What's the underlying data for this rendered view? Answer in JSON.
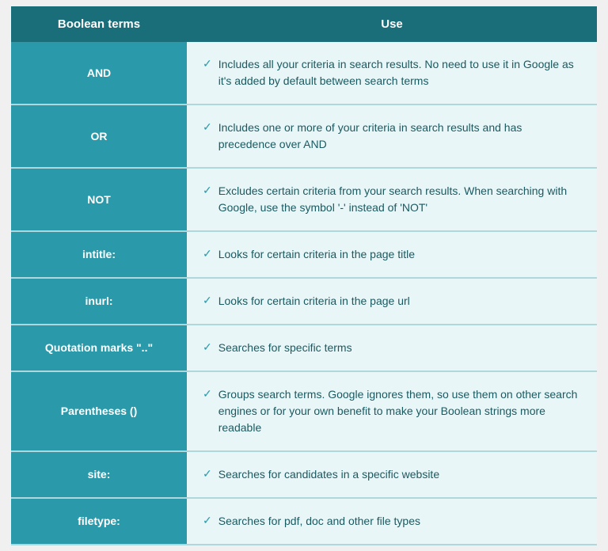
{
  "table": {
    "header": {
      "col1": "Boolean terms",
      "col2": "Use"
    },
    "rows": [
      {
        "term": "AND",
        "use": "Includes all your criteria in search results. No need to use it in Google as it's added by default between search terms"
      },
      {
        "term": "OR",
        "use": "Includes one or more of your criteria in search results and has precedence over AND"
      },
      {
        "term": "NOT",
        "use": "Excludes certain criteria from your search results. When searching with Google, use the symbol '-' instead of 'NOT'"
      },
      {
        "term": "intitle:",
        "use": "Looks for certain criteria in the page title"
      },
      {
        "term": "inurl:",
        "use": "Looks for certain criteria in the page url"
      },
      {
        "term": "Quotation marks \"..\"",
        "use": "Searches for specific terms"
      },
      {
        "term": "Parentheses ()",
        "use": "Groups search terms. Google ignores them, so use them on other search engines or for your own benefit to make your Boolean strings more readable"
      },
      {
        "term": "site:",
        "use": "Searches for candidates in a specific website"
      },
      {
        "term": "filetype:",
        "use": "Searches for pdf, doc and other file types"
      }
    ],
    "checkmark": "✓"
  }
}
